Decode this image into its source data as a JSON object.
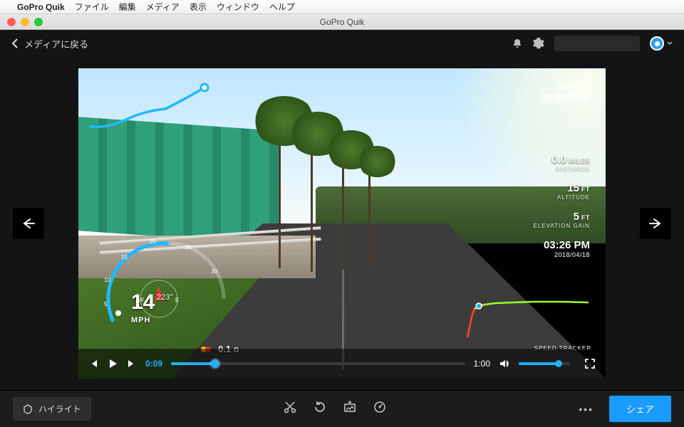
{
  "menubar": {
    "app_name": "GoPro Quik",
    "items": [
      "ファイル",
      "編集",
      "メディア",
      "表示",
      "ウィンドウ",
      "ヘルプ"
    ]
  },
  "window": {
    "title": "GoPro Quik"
  },
  "appbar": {
    "back_label": "メディアに戻る"
  },
  "overlay": {
    "logo": "GoPro",
    "telemetry": {
      "distance": {
        "value": "0.0",
        "unit": "MILES",
        "label": "DISTANCE"
      },
      "altitude": {
        "value": "15",
        "unit": "FT",
        "label": "ALTITUDE"
      },
      "elevation_gain": {
        "value": "5",
        "unit": "FT",
        "label": "ELEVATION GAIN"
      },
      "time": "03:26 PM",
      "date": "2018/04/18"
    },
    "gauge": {
      "speed_value": "14",
      "speed_unit": "MPH",
      "heading_deg": "223°",
      "tick_5": "5",
      "tick_10": "10",
      "tick_15": "15",
      "tick_20": "20",
      "tick_25": "25",
      "tick_30": "30",
      "compass_w": "W",
      "compass_e": "E"
    },
    "gforce": {
      "value": "0.1",
      "unit": "G"
    },
    "speed_tracker_label": "SPEED TRACKER"
  },
  "player": {
    "current_time": "0:09",
    "duration": "1:00",
    "progress_pct": 15,
    "volume_pct": 78
  },
  "toolbar": {
    "highlight_label": "ハイライト",
    "share_label": "シェア"
  }
}
